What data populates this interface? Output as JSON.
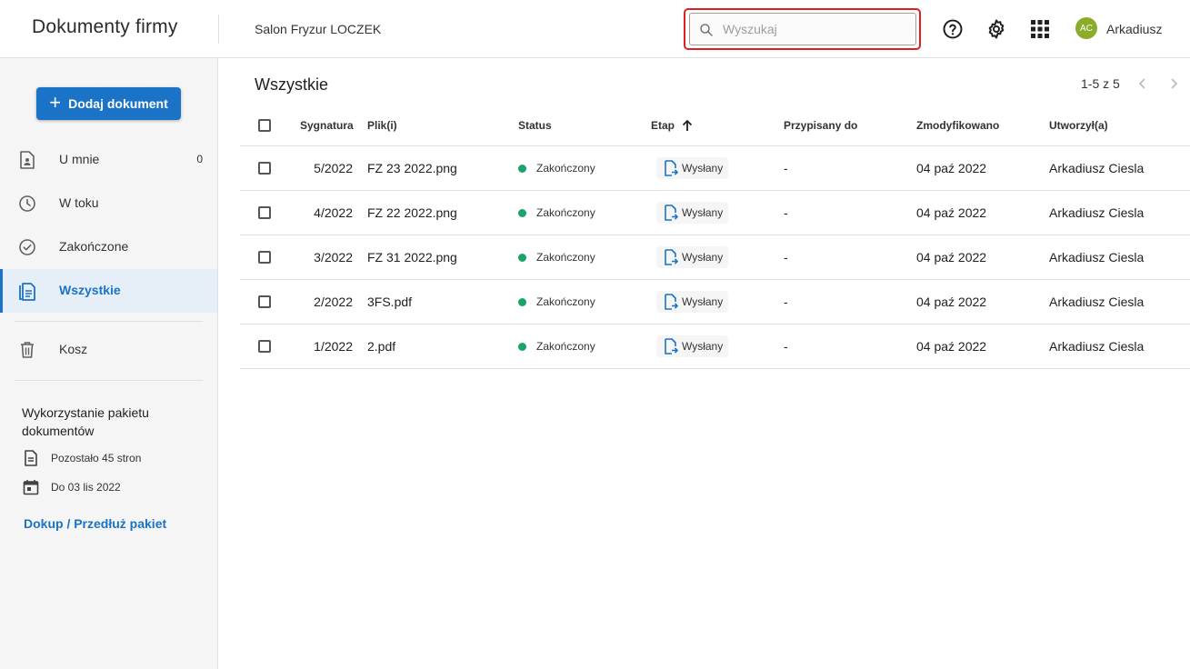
{
  "app": {
    "title": "Dokumenty firmy",
    "company": "Salon Fryzur LOCZEK"
  },
  "search": {
    "placeholder": "Wyszukaj",
    "value": ""
  },
  "user": {
    "initials": "AC",
    "name": "Arkadiusz"
  },
  "sidebar": {
    "add_label": "Dodaj dokument",
    "items": [
      {
        "label": "U mnie",
        "count": "0"
      },
      {
        "label": "W toku"
      },
      {
        "label": "Zakończone"
      },
      {
        "label": "Wszystkie"
      },
      {
        "label": "Kosz"
      }
    ],
    "usage": {
      "title": "Wykorzystanie pakietu dokumentów",
      "pages_left": "Pozostało 45 stron",
      "valid_until": "Do 03 lis 2022",
      "renew_link": "Dokup / Przedłuż pakiet"
    }
  },
  "main": {
    "title": "Wszystkie",
    "pagination": "1-5 z 5",
    "columns": {
      "signature": "Sygnatura",
      "files": "Plik(i)",
      "status": "Status",
      "stage": "Etap",
      "assigned": "Przypisany do",
      "modified": "Zmodyfikowano",
      "created_by": "Utworzył(a)"
    },
    "rows": [
      {
        "signature": "5/2022",
        "file": "FZ 23 2022.png",
        "status": "Zakończony",
        "stage": "Wysłany",
        "assigned": "-",
        "modified": "04 paź 2022",
        "created_by": "Arkadiusz Ciesla"
      },
      {
        "signature": "4/2022",
        "file": "FZ 22 2022.png",
        "status": "Zakończony",
        "stage": "Wysłany",
        "assigned": "-",
        "modified": "04 paź 2022",
        "created_by": "Arkadiusz Ciesla"
      },
      {
        "signature": "3/2022",
        "file": "FZ 31 2022.png",
        "status": "Zakończony",
        "stage": "Wysłany",
        "assigned": "-",
        "modified": "04 paź 2022",
        "created_by": "Arkadiusz Ciesla"
      },
      {
        "signature": "2/2022",
        "file": "3FS.pdf",
        "status": "Zakończony",
        "stage": "Wysłany",
        "assigned": "-",
        "modified": "04 paź 2022",
        "created_by": "Arkadiusz Ciesla"
      },
      {
        "signature": "1/2022",
        "file": "2.pdf",
        "status": "Zakończony",
        "stage": "Wysłany",
        "assigned": "-",
        "modified": "04 paź 2022",
        "created_by": "Arkadiusz Ciesla"
      }
    ]
  },
  "colors": {
    "accent": "#1a73c7",
    "status_done": "#1aa36b",
    "highlight": "#e02020",
    "avatar": "#8bab2a"
  }
}
